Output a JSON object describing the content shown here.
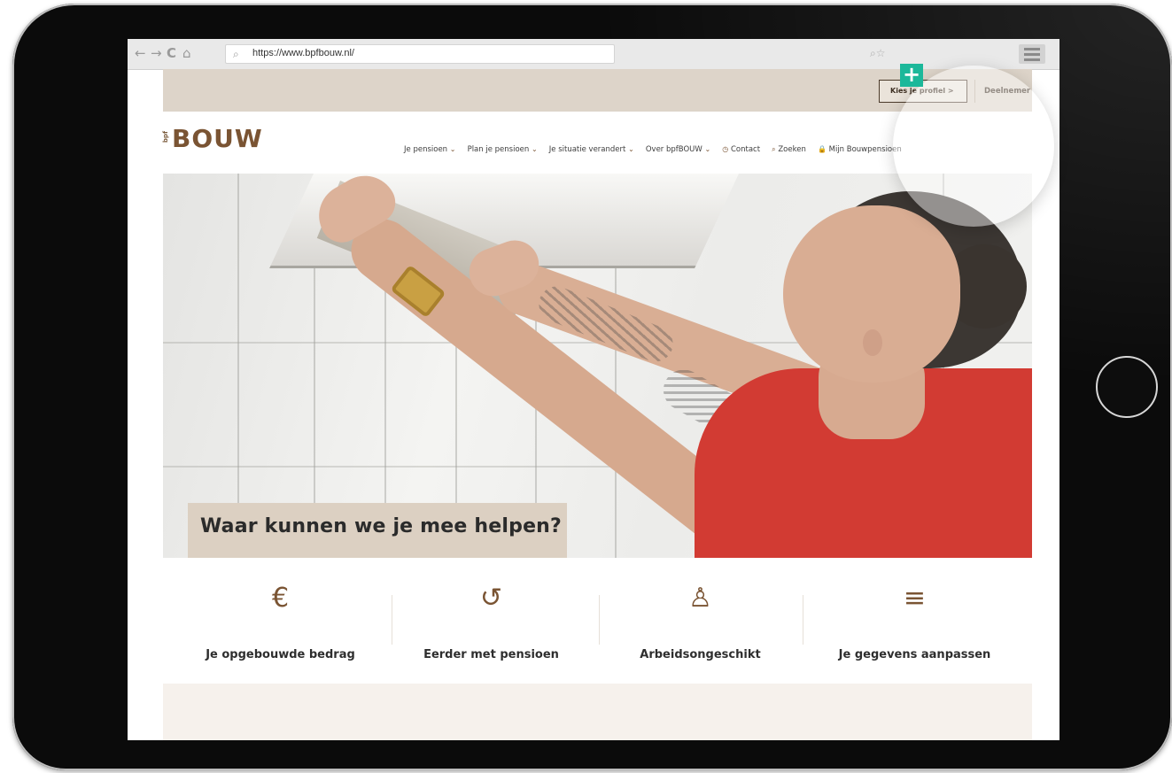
{
  "browser": {
    "url": "https://www.bpfbouw.nl/",
    "search_glyph": "🔍"
  },
  "topbar": {
    "profile_button": "Kies je profiel >",
    "role_label": "Deelnemer"
  },
  "header": {
    "logo_prefix": "bpf",
    "logo_word": "BOUW",
    "nav": [
      {
        "label": "Je pensioen",
        "has_dropdown": true
      },
      {
        "label": "Plan je pensioen",
        "has_dropdown": true
      },
      {
        "label": "Je situatie verandert",
        "has_dropdown": true
      },
      {
        "label": "Over bpfBOUW",
        "has_dropdown": true
      },
      {
        "label": "Contact",
        "icon": "clock-icon"
      },
      {
        "label": "Zoeken",
        "icon": "search-icon"
      },
      {
        "label": "Mijn Bouwpensioen",
        "icon": "lock-icon"
      }
    ]
  },
  "hero": {
    "title": "Waar kunnen we je mee helpen?"
  },
  "quicklinks": [
    {
      "icon": "euro-icon",
      "glyph": "€",
      "label": "Je opgebouwde bedrag"
    },
    {
      "icon": "history-icon",
      "glyph": "↺",
      "label": "Eerder met pensioen"
    },
    {
      "icon": "person-bandage-icon",
      "glyph": "♙",
      "label": "Arbeidsongeschikt"
    },
    {
      "icon": "edit-list-icon",
      "glyph": "≡",
      "label": "Je gegevens aanpassen"
    }
  ],
  "colors": {
    "brand_brown": "#7a5433",
    "beige": "#ddd4c9",
    "badge_teal": "#1cb89a",
    "shirt_red": "#d23b33"
  }
}
